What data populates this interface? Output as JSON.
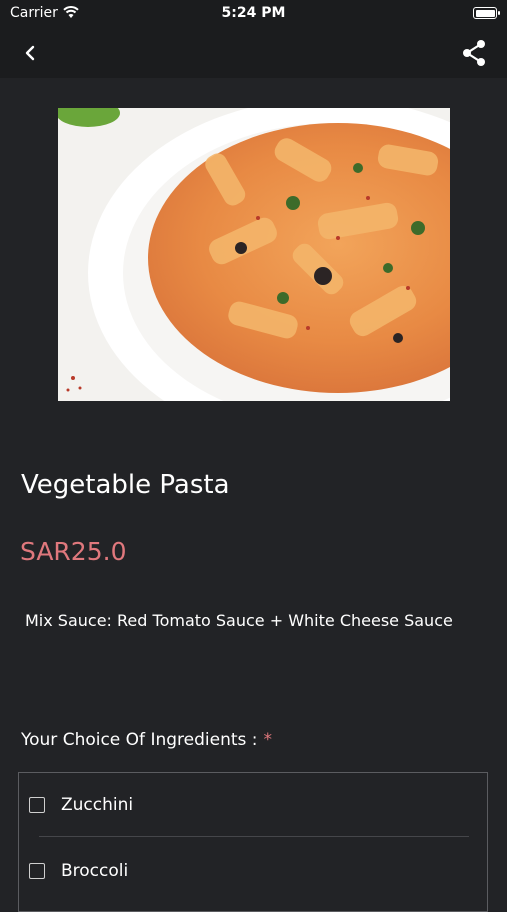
{
  "status_bar": {
    "carrier": "Carrier",
    "time": "5:24 PM"
  },
  "nav": {
    "back_icon": "chevron-left-icon",
    "share_icon": "share-icon"
  },
  "product": {
    "title": "Vegetable Pasta",
    "price": "SAR25.0",
    "description": "Mix Sauce: Red Tomato Sauce + White Cheese Sauce"
  },
  "ingredients": {
    "label": "Your Choice Of Ingredients :",
    "required_marker": "*",
    "options": [
      {
        "label": "Zucchini",
        "checked": false
      },
      {
        "label": "Broccoli",
        "checked": false
      }
    ]
  },
  "colors": {
    "background": "#222326",
    "bar": "#1b1c1e",
    "price": "#e0787d"
  }
}
